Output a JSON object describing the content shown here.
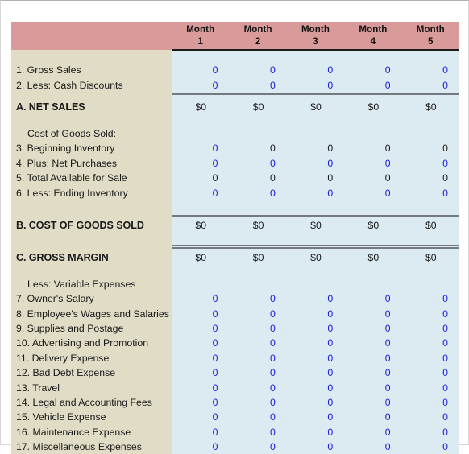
{
  "document": {
    "type": "spreadsheet",
    "title": "Cash Flow / Income Statement Worksheet"
  },
  "colors": {
    "header_background": "#d99a9a",
    "label_background": "#e0dcc6",
    "data_background": "#dcebf2",
    "input_value": "#1a1ae0",
    "computed_value": "#1a1a1a",
    "rule": "#73797e"
  },
  "columns": {
    "label_header": "",
    "months": [
      {
        "name": "Month",
        "number": "1"
      },
      {
        "name": "Month",
        "number": "2"
      },
      {
        "name": "Month",
        "number": "3"
      },
      {
        "name": "Month",
        "number": "4"
      },
      {
        "name": "Month",
        "number": "5"
      }
    ]
  },
  "rows": [
    {
      "kind": "spacer",
      "label": "",
      "values": [
        "",
        "",
        "",
        "",
        ""
      ]
    },
    {
      "kind": "item",
      "label": "1. Gross Sales",
      "values": [
        "0",
        "0",
        "0",
        "0",
        "0"
      ],
      "styles": [
        "input",
        "input",
        "input",
        "input",
        "input"
      ]
    },
    {
      "kind": "item",
      "label": "2. Less: Cash Discounts",
      "values": [
        "0",
        "0",
        "0",
        "0",
        "0"
      ],
      "styles": [
        "input",
        "input",
        "input",
        "input",
        "input"
      ]
    },
    {
      "kind": "section",
      "rule": "single",
      "label": "A. NET SALES",
      "values": [
        "$0",
        "$0",
        "$0",
        "$0",
        "$0"
      ]
    },
    {
      "kind": "spacer",
      "label": "",
      "values": [
        "",
        "",
        "",
        "",
        ""
      ]
    },
    {
      "kind": "subheading",
      "label": "Cost of Goods Sold:",
      "values": [
        "",
        "",
        "",
        "",
        ""
      ]
    },
    {
      "kind": "item",
      "label": "3. Beginning Inventory",
      "values": [
        "0",
        "0",
        "0",
        "0",
        "0"
      ],
      "styles": [
        "input",
        "computed",
        "computed",
        "computed",
        "computed"
      ]
    },
    {
      "kind": "item",
      "label": "4. Plus: Net Purchases",
      "values": [
        "0",
        "0",
        "0",
        "0",
        "0"
      ],
      "styles": [
        "input",
        "input",
        "input",
        "input",
        "input"
      ]
    },
    {
      "kind": "item",
      "label": "5. Total Available for Sale",
      "values": [
        "0",
        "0",
        "0",
        "0",
        "0"
      ],
      "styles": [
        "computed",
        "computed",
        "computed",
        "computed",
        "computed"
      ]
    },
    {
      "kind": "item",
      "label": "6. Less: Ending Inventory",
      "values": [
        "0",
        "0",
        "0",
        "0",
        "0"
      ],
      "styles": [
        "input",
        "input",
        "input",
        "input",
        "input"
      ]
    },
    {
      "kind": "spacer",
      "label": "",
      "values": [
        "",
        "",
        "",
        "",
        ""
      ]
    },
    {
      "kind": "section",
      "rule": "double",
      "label": "B. COST OF GOODS SOLD",
      "values": [
        "$0",
        "$0",
        "$0",
        "$0",
        "$0"
      ]
    },
    {
      "kind": "spacer",
      "label": "",
      "values": [
        "",
        "",
        "",
        "",
        ""
      ]
    },
    {
      "kind": "section",
      "rule": "double",
      "label": "C. GROSS MARGIN",
      "values": [
        "$0",
        "$0",
        "$0",
        "$0",
        "$0"
      ]
    },
    {
      "kind": "spacer",
      "label": "",
      "values": [
        "",
        "",
        "",
        "",
        ""
      ]
    },
    {
      "kind": "subheading",
      "label": "Less: Variable Expenses",
      "values": [
        "",
        "",
        "",
        "",
        ""
      ]
    },
    {
      "kind": "item",
      "label": "7. Owner's Salary",
      "values": [
        "0",
        "0",
        "0",
        "0",
        "0"
      ],
      "styles": [
        "input",
        "input",
        "input",
        "input",
        "input"
      ]
    },
    {
      "kind": "item",
      "label": "8. Employee's Wages and Salaries",
      "values": [
        "0",
        "0",
        "0",
        "0",
        "0"
      ],
      "styles": [
        "input",
        "input",
        "input",
        "input",
        "input"
      ]
    },
    {
      "kind": "item",
      "label": "9. Supplies and Postage",
      "values": [
        "0",
        "0",
        "0",
        "0",
        "0"
      ],
      "styles": [
        "input",
        "input",
        "input",
        "input",
        "input"
      ]
    },
    {
      "kind": "item",
      "label": "10. Advertising and Promotion",
      "values": [
        "0",
        "0",
        "0",
        "0",
        "0"
      ],
      "styles": [
        "input",
        "input",
        "input",
        "input",
        "input"
      ]
    },
    {
      "kind": "item",
      "label": "11. Delivery Expense",
      "values": [
        "0",
        "0",
        "0",
        "0",
        "0"
      ],
      "styles": [
        "input",
        "input",
        "input",
        "input",
        "input"
      ]
    },
    {
      "kind": "item",
      "label": "12. Bad Debt Expense",
      "values": [
        "0",
        "0",
        "0",
        "0",
        "0"
      ],
      "styles": [
        "input",
        "input",
        "input",
        "input",
        "input"
      ]
    },
    {
      "kind": "item",
      "label": "13. Travel",
      "values": [
        "0",
        "0",
        "0",
        "0",
        "0"
      ],
      "styles": [
        "input",
        "input",
        "input",
        "input",
        "input"
      ]
    },
    {
      "kind": "item",
      "label": "14. Legal and Accounting Fees",
      "values": [
        "0",
        "0",
        "0",
        "0",
        "0"
      ],
      "styles": [
        "input",
        "input",
        "input",
        "input",
        "input"
      ]
    },
    {
      "kind": "item",
      "label": "15. Vehicle Expense",
      "values": [
        "0",
        "0",
        "0",
        "0",
        "0"
      ],
      "styles": [
        "input",
        "input",
        "input",
        "input",
        "input"
      ]
    },
    {
      "kind": "item",
      "label": "16. Maintenance Expense",
      "values": [
        "0",
        "0",
        "0",
        "0",
        "0"
      ],
      "styles": [
        "input",
        "input",
        "input",
        "input",
        "input"
      ]
    },
    {
      "kind": "item",
      "label": "17. Miscellaneous Expenses",
      "values": [
        "0",
        "0",
        "0",
        "0",
        "0"
      ],
      "styles": [
        "input",
        "input",
        "input",
        "input",
        "input"
      ]
    }
  ]
}
